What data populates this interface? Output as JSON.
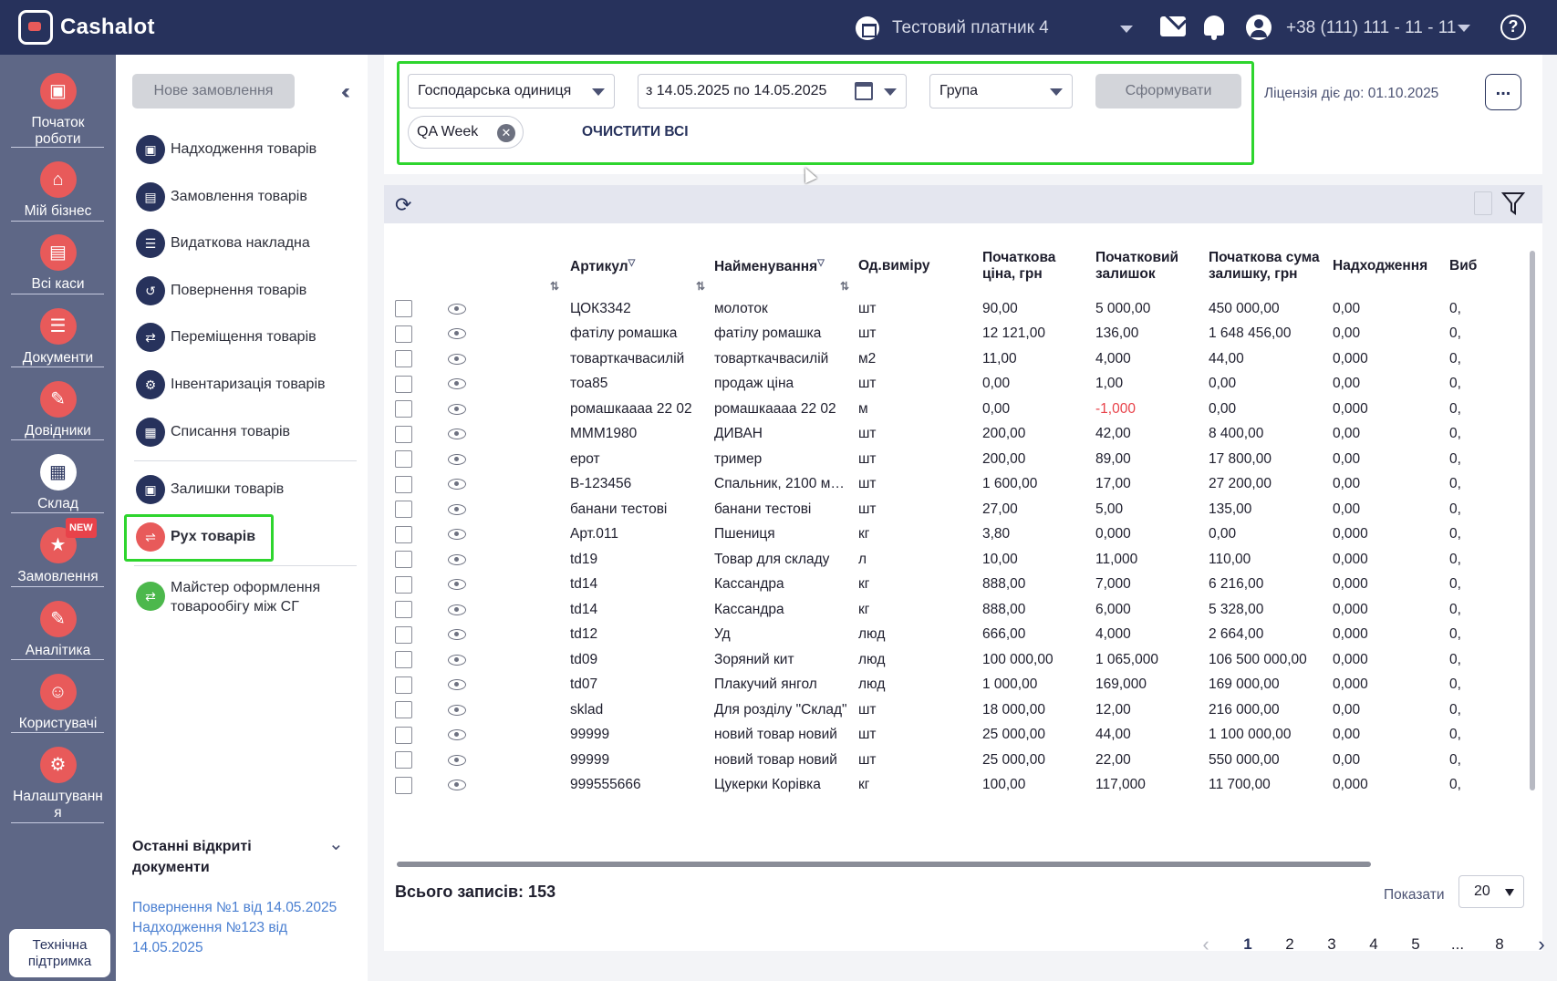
{
  "app": {
    "logo_text": "Cashalot",
    "business": "Тестовий платник 4",
    "phone": "+38 (111) 111 - 11 - 11",
    "help": "?"
  },
  "rail": {
    "items": [
      {
        "label": "Початок роботи",
        "icon": "briefcase-icon"
      },
      {
        "label": "Мій бізнес",
        "icon": "home-icon"
      },
      {
        "label": "Всі каси",
        "icon": "cash-register-icon"
      },
      {
        "label": "Документи",
        "icon": "documents-icon"
      },
      {
        "label": "Довідники",
        "icon": "reference-icon"
      },
      {
        "label": "Склад",
        "icon": "warehouse-icon"
      },
      {
        "label": "Замовлення",
        "icon": "scooter-icon"
      },
      {
        "label": "Аналітика",
        "icon": "analytics-icon"
      },
      {
        "label": "Користувачі",
        "icon": "users-icon"
      },
      {
        "label": "Налаштування",
        "icon": "settings-icon"
      }
    ],
    "new_badge": "NEW",
    "support": "Технічна підтримка"
  },
  "submenu": {
    "new_order": "Нове замовлення",
    "items": [
      "Надходження товарів",
      "Замовлення товарів",
      "Видаткова накладна",
      "Повернення товарів",
      "Переміщення товарів",
      "Інвентаризація товарів",
      "Списання товарів",
      "Залишки товарів",
      "Рух товарів",
      "Майстер оформлення товарообігу між СГ"
    ],
    "recent_title": "Останні відкриті документи",
    "recent": [
      "Повернення №1 від 14.05.2025",
      "Надходження №123 від 14.05.2025"
    ]
  },
  "filters": {
    "unit": "Господарська одиниця",
    "period": "з 14.05.2025 по 14.05.2025",
    "group": "Група",
    "form_button": "Сформувати",
    "chip": "QA Week",
    "clear_all": "ОЧИСТИТИ ВСІ",
    "license": "Ліцензія діє до: 01.10.2025",
    "more": "..."
  },
  "table": {
    "headers": [
      "Артикул",
      "Найменування",
      "Од.виміру",
      "Початкова ціна, грн",
      "Початковий залишок",
      "Початкова сума залишку, грн",
      "Надходження",
      "Виб"
    ],
    "rows": [
      [
        "ЦОК3342",
        "молоток",
        "шт",
        "90,00",
        "5 000,00",
        "450 000,00",
        "0,00",
        "0,"
      ],
      [
        "фатілу ромашка",
        "фатілу ромашка",
        "шт",
        "12 121,00",
        "136,00",
        "1 648 456,00",
        "0,00",
        "0,"
      ],
      [
        "товарткачвасилій",
        "товарткачвасилій",
        "м2",
        "11,00",
        "4,000",
        "44,00",
        "0,000",
        "0,"
      ],
      [
        "тоа85",
        "продаж ціна",
        "шт",
        "0,00",
        "1,00",
        "0,00",
        "0,00",
        "0,"
      ],
      [
        "ромашкаааа 22 02",
        "ромашкаааа 22 02",
        "м",
        "0,00",
        "-1,000",
        "0,00",
        "0,000",
        "0,"
      ],
      [
        "МММ1980",
        "ДИВАН",
        "шт",
        "200,00",
        "42,00",
        "8 400,00",
        "0,00",
        "0,"
      ],
      [
        "ерот",
        "тример",
        "шт",
        "200,00",
        "89,00",
        "17 800,00",
        "0,00",
        "0,"
      ],
      [
        "В-123456",
        "Спальник, 2100 мм, ...",
        "шт",
        "1 600,00",
        "17,00",
        "27 200,00",
        "0,00",
        "0,"
      ],
      [
        "банани тестові",
        "банани тестові",
        "шт",
        "27,00",
        "5,00",
        "135,00",
        "0,00",
        "0,"
      ],
      [
        "Арт.011",
        "Пшениця",
        "кг",
        "3,80",
        "0,000",
        "0,00",
        "0,000",
        "0,"
      ],
      [
        "td19",
        "Товар для складу",
        "л",
        "10,00",
        "11,000",
        "110,00",
        "0,000",
        "0,"
      ],
      [
        "td14",
        "Кассандра",
        "кг",
        "888,00",
        "7,000",
        "6 216,00",
        "0,000",
        "0,"
      ],
      [
        "td14",
        "Кассандра",
        "кг",
        "888,00",
        "6,000",
        "5 328,00",
        "0,000",
        "0,"
      ],
      [
        "td12",
        "Уд",
        "люд",
        "666,00",
        "4,000",
        "2 664,00",
        "0,000",
        "0,"
      ],
      [
        "td09",
        "Зоряний кит",
        "люд",
        "100 000,00",
        "1 065,000",
        "106 500 000,00",
        "0,000",
        "0,"
      ],
      [
        "td07",
        "Плакучий янгол",
        "люд",
        "1 000,00",
        "169,000",
        "169 000,00",
        "0,000",
        "0,"
      ],
      [
        "sklad",
        "Для розділу \"Склад\"",
        "шт",
        "18 000,00",
        "12,00",
        "216 000,00",
        "0,00",
        "0,"
      ],
      [
        "99999",
        "новий товар новий",
        "шт",
        "25 000,00",
        "44,00",
        "1 100 000,00",
        "0,00",
        "0,"
      ],
      [
        "99999",
        "новий товар новий",
        "шт",
        "25 000,00",
        "22,00",
        "550 000,00",
        "0,00",
        "0,"
      ],
      [
        "999555666",
        "Цукерки Корівка",
        "кг",
        "100,00",
        "117,000",
        "11 700,00",
        "0,000",
        "0,"
      ]
    ],
    "total_label": "Всього записів: 153",
    "show_label": "Показати",
    "page_size": "20",
    "pages": [
      "1",
      "2",
      "3",
      "4",
      "5",
      "...",
      "8"
    ]
  },
  "colors": {
    "header_bg": "#27325c",
    "rail_bg": "#5e6786",
    "accent_red": "#e85a5a",
    "highlight_green": "#2ed52e",
    "link_blue": "#4a7fd1",
    "negative": "#e8424a"
  }
}
